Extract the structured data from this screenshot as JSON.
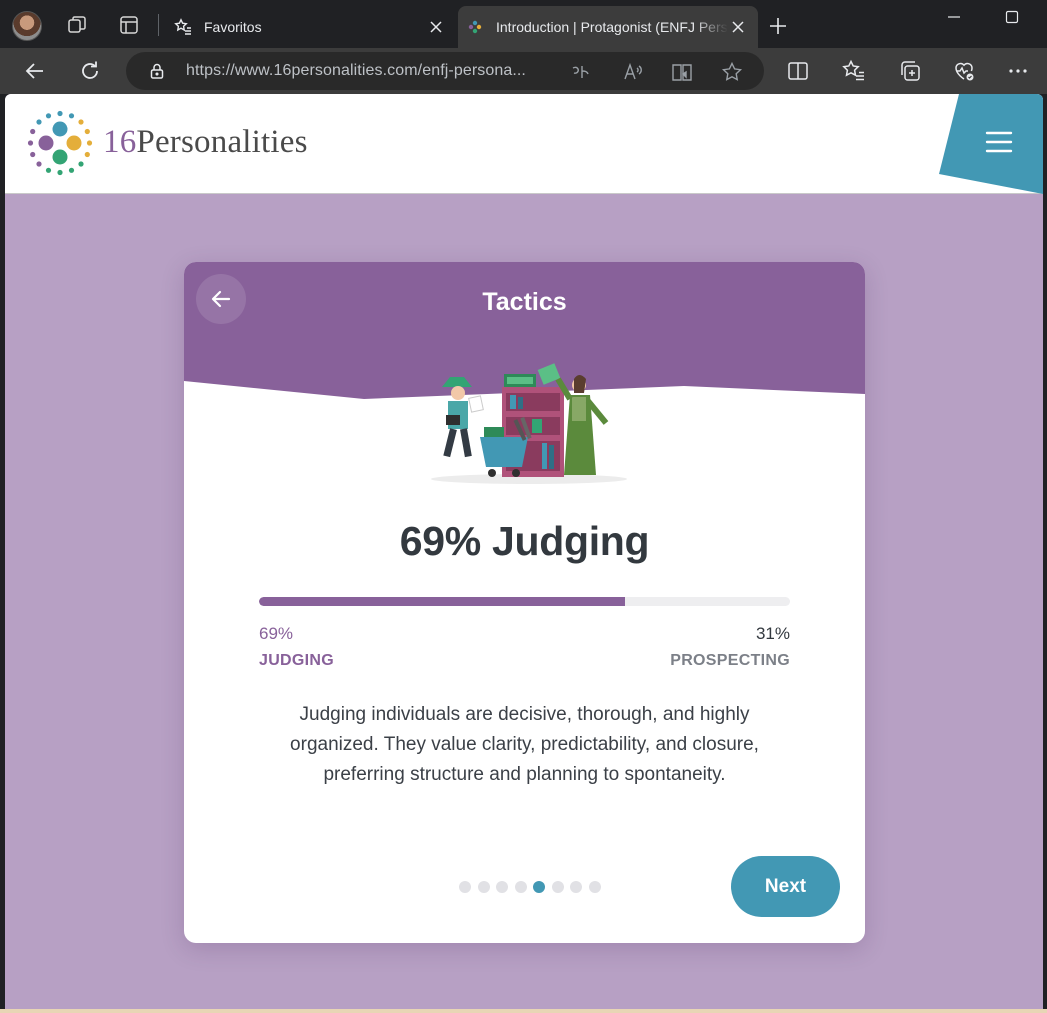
{
  "browser": {
    "tabs": [
      {
        "title": "Favoritos",
        "icon": "star-list-icon",
        "active": false
      },
      {
        "title": "Introduction | Protagonist (ENFJ Personality)",
        "icon": "16personalities-favicon",
        "active": true
      }
    ],
    "address": {
      "url": "https://www.16personalities.com/enfj-persona..."
    }
  },
  "site": {
    "logo": {
      "number": "16",
      "name": "Personalities"
    }
  },
  "card": {
    "title": "Tactics",
    "result_heading": "69% Judging",
    "trait_bar": {
      "fraction_judging": 0.69
    },
    "left": {
      "percent": "69%",
      "label": "JUDGING"
    },
    "right": {
      "percent": "31%",
      "label": "PROSPECTING"
    },
    "description": "Judging individuals are decisive, thorough, and highly organized. They value clarity, predictability, and closure, preferring structure and planning to spontaneity.",
    "pagination": {
      "total": 8,
      "current": 5
    },
    "next_label": "Next"
  },
  "colors": {
    "page_background": "#b7a0c4",
    "card_header": "#88619a",
    "accent_blue": "#4298b4",
    "judging_purple": "#88619a"
  }
}
